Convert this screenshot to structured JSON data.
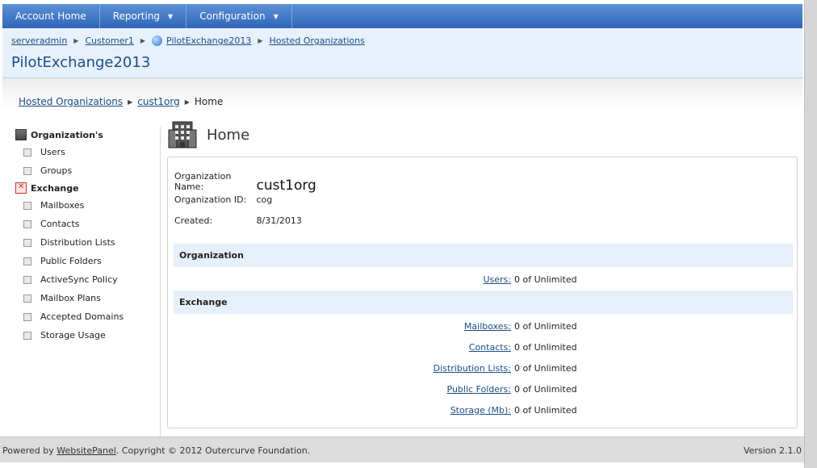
{
  "nav": {
    "items": [
      {
        "label": "Account Home",
        "dropdown": false
      },
      {
        "label": "Reporting",
        "dropdown": true
      },
      {
        "label": "Configuration",
        "dropdown": true
      }
    ]
  },
  "header": {
    "breadcrumb": [
      "serveradmin",
      "Customer1",
      "PilotExchange2013",
      "Hosted Organizations"
    ],
    "title": "PilotExchange2013"
  },
  "content_breadcrumb": {
    "link1": "Hosted Organizations",
    "link2": "cust1org",
    "current": "Home"
  },
  "sidebar": {
    "org_heading": "Organization's",
    "org_items": [
      "Users",
      "Groups"
    ],
    "exchange_heading": "Exchange",
    "exchange_items": [
      "Mailboxes",
      "Contacts",
      "Distribution Lists",
      "Public Folders",
      "ActiveSync Policy",
      "Mailbox Plans",
      "Accepted Domains",
      "Storage Usage"
    ]
  },
  "main": {
    "title": "Home",
    "org_name_label": "Organization Name:",
    "org_name": "cust1org",
    "org_id_label": "Organization ID:",
    "org_id": "cog",
    "created_label": "Created:",
    "created": "8/31/2013",
    "organization_section": "Organization",
    "org_stats": [
      {
        "label": "Users:",
        "value": "0 of Unlimited"
      }
    ],
    "exchange_section": "Exchange",
    "exchange_stats": [
      {
        "label": "Mailboxes:",
        "value": "0 of Unlimited"
      },
      {
        "label": "Contacts:",
        "value": "0 of Unlimited"
      },
      {
        "label": "Distribution Lists:",
        "value": "0 of Unlimited"
      },
      {
        "label": "Public Folders:",
        "value": "0 of Unlimited"
      },
      {
        "label": "Storage (Mb):",
        "value": "0 of Unlimited"
      }
    ]
  },
  "footer": {
    "powered_prefix": "Powered by ",
    "powered_link": "WebsitePanel",
    "powered_suffix": ". Copyright © 2012 Outercurve Foundation.",
    "version": "Version 2.1.0"
  }
}
